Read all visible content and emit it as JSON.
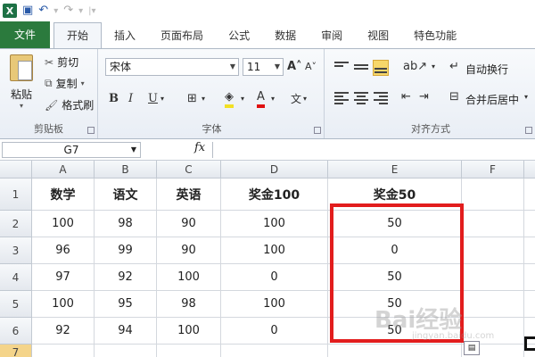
{
  "ribbon_tabs": [
    "文件",
    "开始",
    "插入",
    "页面布局",
    "公式",
    "数据",
    "审阅",
    "视图",
    "特色功能"
  ],
  "clipboard": {
    "paste": "粘贴",
    "cut": "剪切",
    "copy": "复制",
    "format_painter": "格式刷",
    "group_label": "剪贴板"
  },
  "font": {
    "name": "宋体",
    "size": "11",
    "group_label": "字体",
    "bold": "B",
    "italic": "I",
    "underline": "U"
  },
  "alignment": {
    "wrap_text": "自动换行",
    "merge_center": "合并后居中",
    "group_label": "对齐方式"
  },
  "formula_bar": {
    "name_box": "G7",
    "fx": "fx",
    "content": ""
  },
  "columns": [
    "A",
    "B",
    "C",
    "D",
    "E",
    "F"
  ],
  "rows": [
    "1",
    "2",
    "3",
    "4",
    "5",
    "6",
    "7"
  ],
  "table": [
    [
      "数学",
      "语文",
      "英语",
      "奖金100",
      "奖金50",
      ""
    ],
    [
      "100",
      "98",
      "90",
      "100",
      "50",
      ""
    ],
    [
      "96",
      "99",
      "90",
      "100",
      "0",
      ""
    ],
    [
      "97",
      "92",
      "100",
      "0",
      "50",
      ""
    ],
    [
      "100",
      "95",
      "98",
      "100",
      "50",
      ""
    ],
    [
      "92",
      "94",
      "100",
      "0",
      "50",
      ""
    ],
    [
      "",
      "",
      "",
      "",
      "",
      ""
    ]
  ],
  "watermark": {
    "text": "Bai经验",
    "url": "jingyan.baidu.com"
  },
  "colors": {
    "file_tab": "#2b7a3d",
    "highlight_box": "#e21d1d",
    "selected_row_header": "#f4d48a"
  }
}
